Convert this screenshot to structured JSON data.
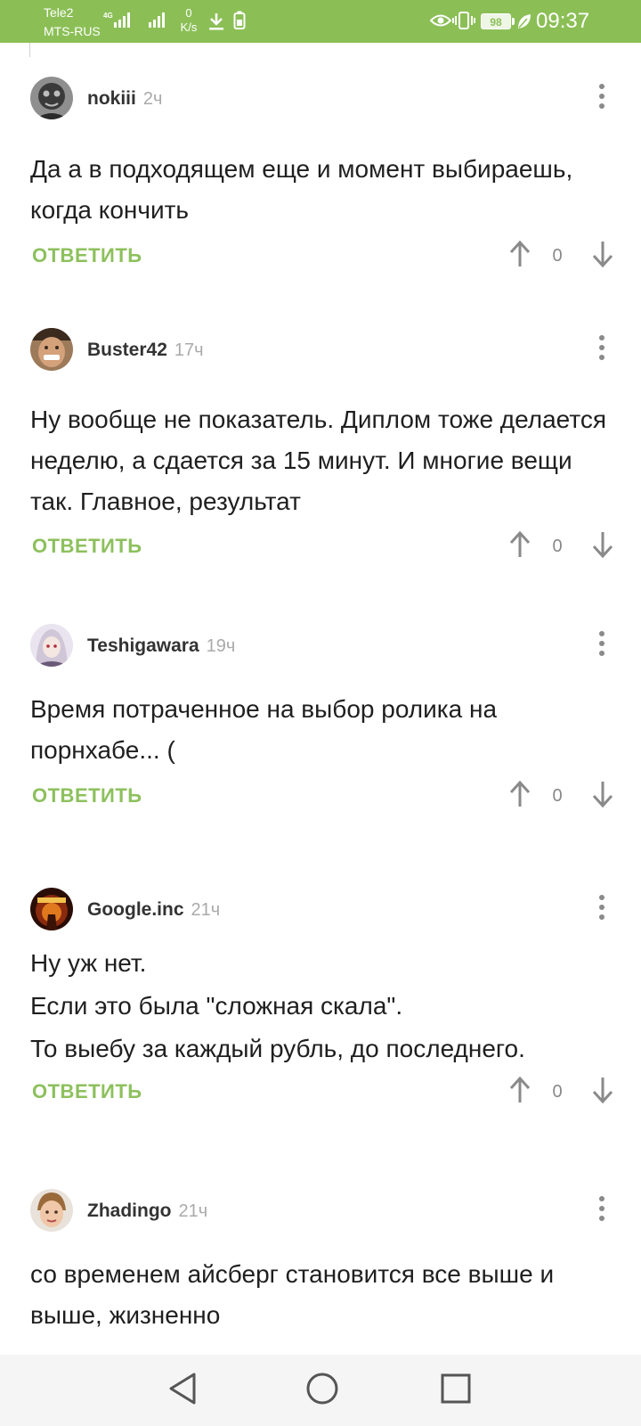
{
  "status_bar": {
    "carrier1": "Tele2",
    "carrier2": "MTS-RUS",
    "network": "4G",
    "speed_value": "0",
    "speed_unit": "K/s",
    "battery": "98",
    "time": "09:37",
    "color": "#8bbf56"
  },
  "comments": [
    {
      "username": "nokiii",
      "time": "2ч",
      "body": [
        "Да а в подходящем еще и момент выбираешь, когда кончить"
      ],
      "reply_label": "ОТВЕТИТЬ",
      "votes": "0"
    },
    {
      "username": "Buster42",
      "time": "17ч",
      "body": [
        "Ну вообще не показатель. Диплом тоже делается неделю, а сдается за 15 минут. И многие вещи так. Главное, результат"
      ],
      "reply_label": "ОТВЕТИТЬ",
      "votes": "0"
    },
    {
      "username": "Teshigawara",
      "time": "19ч",
      "body": [
        "Время потраченное на выбор ролика на порнхабе... ("
      ],
      "reply_label": "ОТВЕТИТЬ",
      "votes": "0"
    },
    {
      "username": "Google.inc",
      "time": "21ч",
      "body": [
        "Ну уж нет.",
        "Если это была \"сложная скала\".",
        "То выебу за каждый рубль, до последнего."
      ],
      "reply_label": "ОТВЕТИТЬ",
      "votes": "0"
    },
    {
      "username": "Zhadingo",
      "time": "21ч",
      "body": [
        "со временем айсберг становится все выше и выше, жизненно"
      ]
    }
  ],
  "colors": {
    "accent": "#8dc05d",
    "icon_gray": "#8a8a8a",
    "meta_gray": "#aaaaaa"
  },
  "nav": {
    "icons": [
      "back-icon",
      "home-icon",
      "recents-icon"
    ]
  }
}
